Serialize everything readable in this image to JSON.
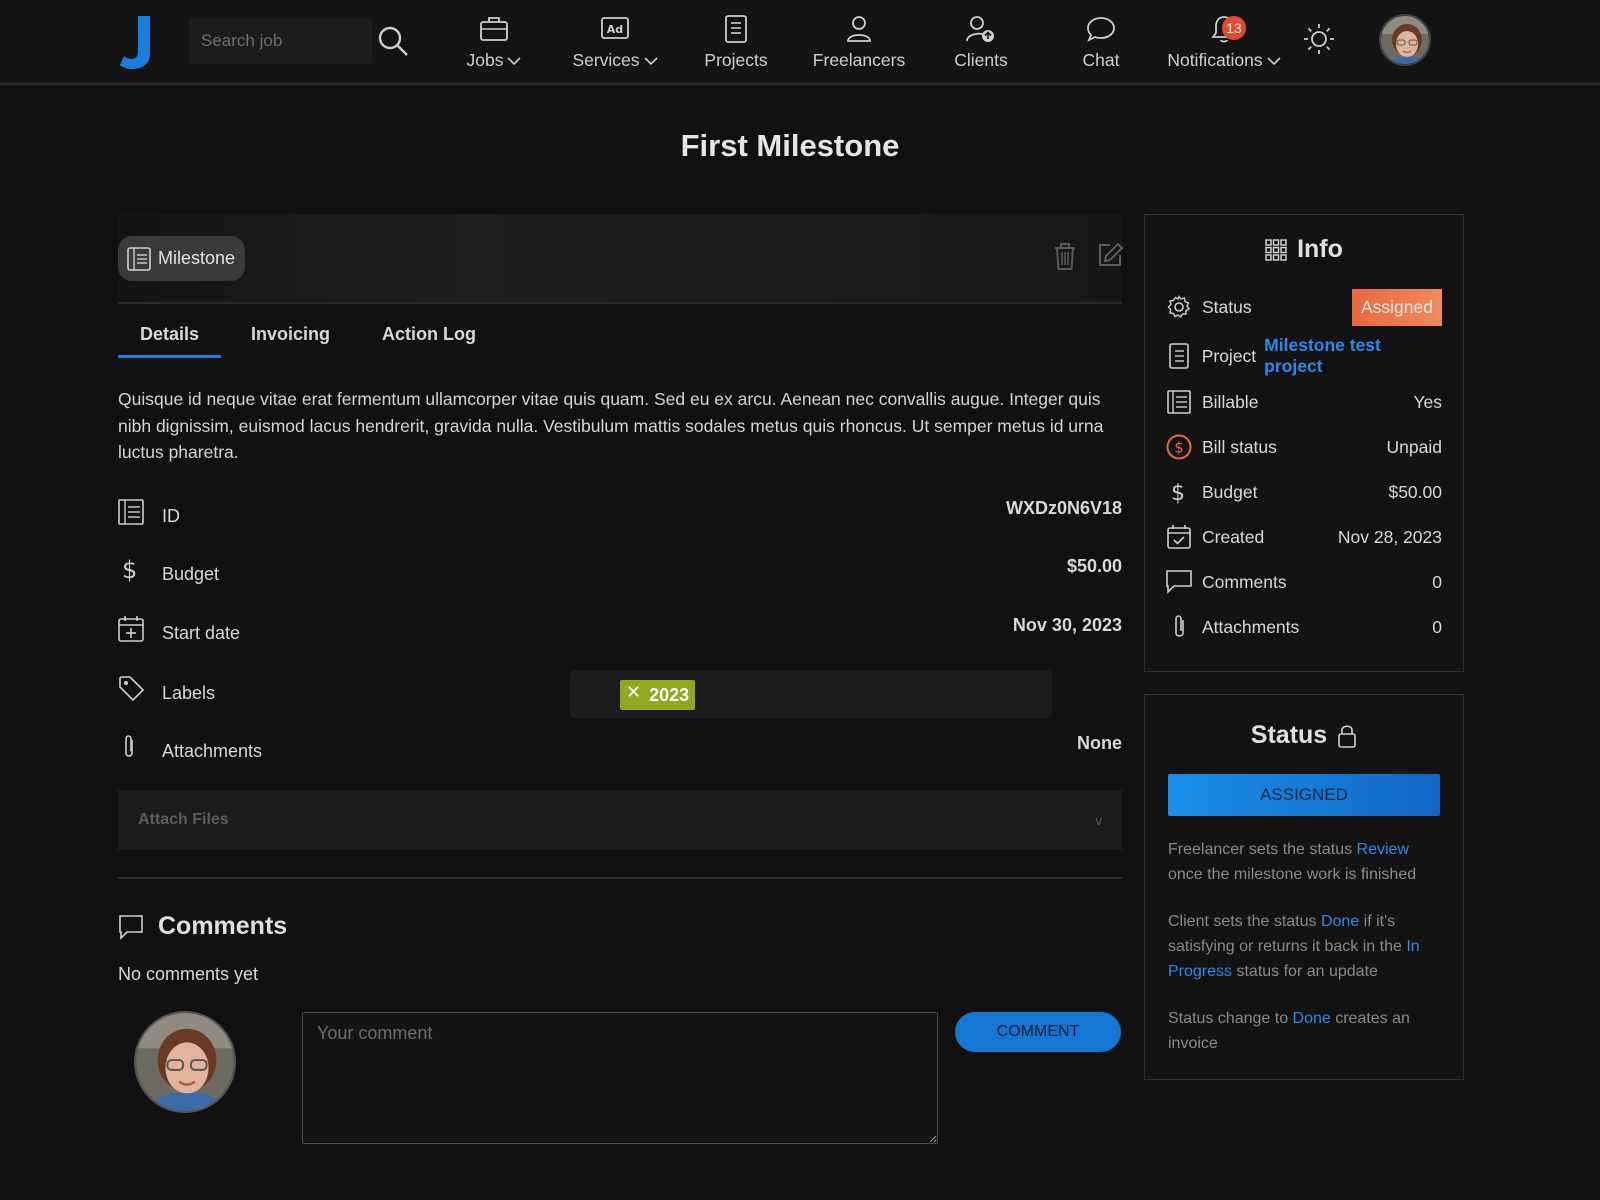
{
  "header": {
    "search_placeholder": "Search job",
    "nav": [
      {
        "label": "Jobs",
        "icon": "briefcase-icon",
        "dropdown": true
      },
      {
        "label": "Services",
        "icon": "ad-icon",
        "dropdown": true
      },
      {
        "label": "Projects",
        "icon": "notebook-icon",
        "dropdown": false
      },
      {
        "label": "Freelancers",
        "icon": "person-icon",
        "dropdown": false
      },
      {
        "label": "Clients",
        "icon": "person-upload-icon",
        "dropdown": false
      },
      {
        "label": "Chat",
        "icon": "chat-bubble-icon",
        "dropdown": false
      },
      {
        "label": "Notifications",
        "icon": "bell-icon",
        "dropdown": true
      }
    ],
    "notifications_count": "13"
  },
  "page": {
    "title": "First Milestone",
    "chip_label": "Milestone",
    "tabs": [
      "Details",
      "Invoicing",
      "Action Log"
    ],
    "description": "Quisque id neque vitae erat fermentum ullamcorper vitae quis quam. Sed eu ex arcu. Aenean nec convallis augue. Integer quis nibh dignissim, euismod lacus hendrerit, gravida nulla. Vestibulum mattis sodales metus quis rhoncus. Ut semper metus id urna luctus pharetra.",
    "details": {
      "id_label": "ID",
      "id_value": "WXDz0N6V18",
      "budget_label": "Budget",
      "budget_value": "$50.00",
      "start_label": "Start date",
      "start_value": "Nov 30, 2023",
      "labels_label": "Labels",
      "label_tag": "2023",
      "attachments_label": "Attachments",
      "attachments_value": "None"
    },
    "attach_files": "Attach Files",
    "attach_chevron": "v",
    "comments_title": "Comments",
    "no_comments": "No comments yet",
    "comment_placeholder": "Your comment",
    "comment_button": "COMMENT"
  },
  "info": {
    "title": "Info",
    "status_label": "Status",
    "status_value": "Assigned",
    "project_label": "Project",
    "project_value": "Milestone test project",
    "billable_label": "Billable",
    "billable_value": "Yes",
    "bill_status_label": "Bill status",
    "bill_status_value": "Unpaid",
    "budget_label": "Budget",
    "budget_value": "$50.00",
    "created_label": "Created",
    "created_value": "Nov 28, 2023",
    "comments_label": "Comments",
    "comments_value": "0",
    "attachments_label": "Attachments",
    "attachments_value": "0"
  },
  "status_panel": {
    "title": "Status",
    "button": "ASSIGNED",
    "p1_a": "Freelancer sets the status ",
    "p1_link": "Review",
    "p1_b": " once the milestone work is finished",
    "p2_a": "Client sets the status ",
    "p2_link1": "Done",
    "p2_b": " if it's satisfying or returns it back in the ",
    "p2_link2": "In Progress",
    "p2_c": " status for an update",
    "p3_a": "Status change to ",
    "p3_link": "Done",
    "p3_b": " creates an invoice"
  },
  "colors": {
    "accent": "#1a7de0",
    "assigned": "#e8683f",
    "label_tag": "#8fa81f",
    "badge": "#e8472f"
  }
}
